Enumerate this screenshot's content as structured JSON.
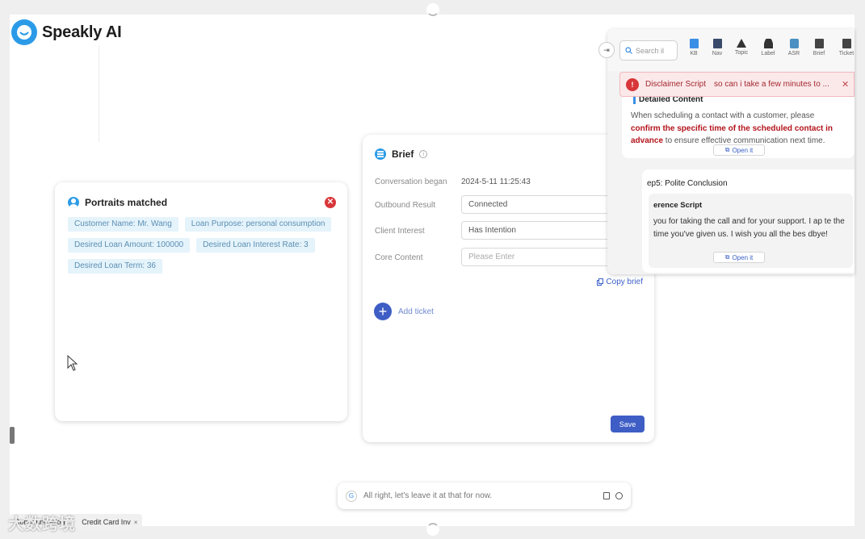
{
  "app": {
    "name": "Speakly AI"
  },
  "portraits": {
    "title": "Portraits matched",
    "tags": [
      "Customer Name: Mr. Wang",
      "Loan Purpose: personal consumption",
      "Desired Loan Amount: 100000",
      "Desired Loan Interest Rate: 3",
      "Desired Loan Term: 36"
    ]
  },
  "brief": {
    "title": "Brief",
    "conversation_began_label": "Conversation began",
    "conversation_began_value": "2024-5-11 11:25:43",
    "outbound_result_label": "Outbound Result",
    "outbound_result_value": "Connected",
    "client_interest_label": "Client Interest",
    "client_interest_value": "Has Intention",
    "core_content_label": "Core Content",
    "core_content_placeholder": "Please Enter",
    "copy_label": "Copy brief",
    "add_ticket_label": "Add ticket",
    "save_label": "Save"
  },
  "right_panel": {
    "search_placeholder": "Search il",
    "tools": [
      "KB",
      "Nav",
      "Topic",
      "Label",
      "ASR",
      "Brief",
      "Ticket"
    ],
    "disclaimer": {
      "title": "Disclaimer Script",
      "text": "so can i take a few minutes to ..."
    },
    "detailed_content": {
      "heading": "Detailed Content",
      "text_pre": "When scheduling a contact with a customer, please ",
      "text_bold": "confirm the specific time of the scheduled contact in advance",
      "text_post": " to ensure effective communication next time.",
      "open_label": "Open it"
    },
    "step": {
      "title": "ep5: Polite Conclusion",
      "script_heading": "erence Script",
      "script_text": "you for taking the call and for your support. I ap te the time you've given us. I wish you all the bes dbye!",
      "open_label": "Open it"
    }
  },
  "chatbar": {
    "text": "All right, let's leave it at that for now."
  },
  "tabs": [
    {
      "label": "Communication",
      "close": "×"
    },
    {
      "label": "Credit Card Inv",
      "close": "×"
    }
  ],
  "watermark": "大数跨境"
}
